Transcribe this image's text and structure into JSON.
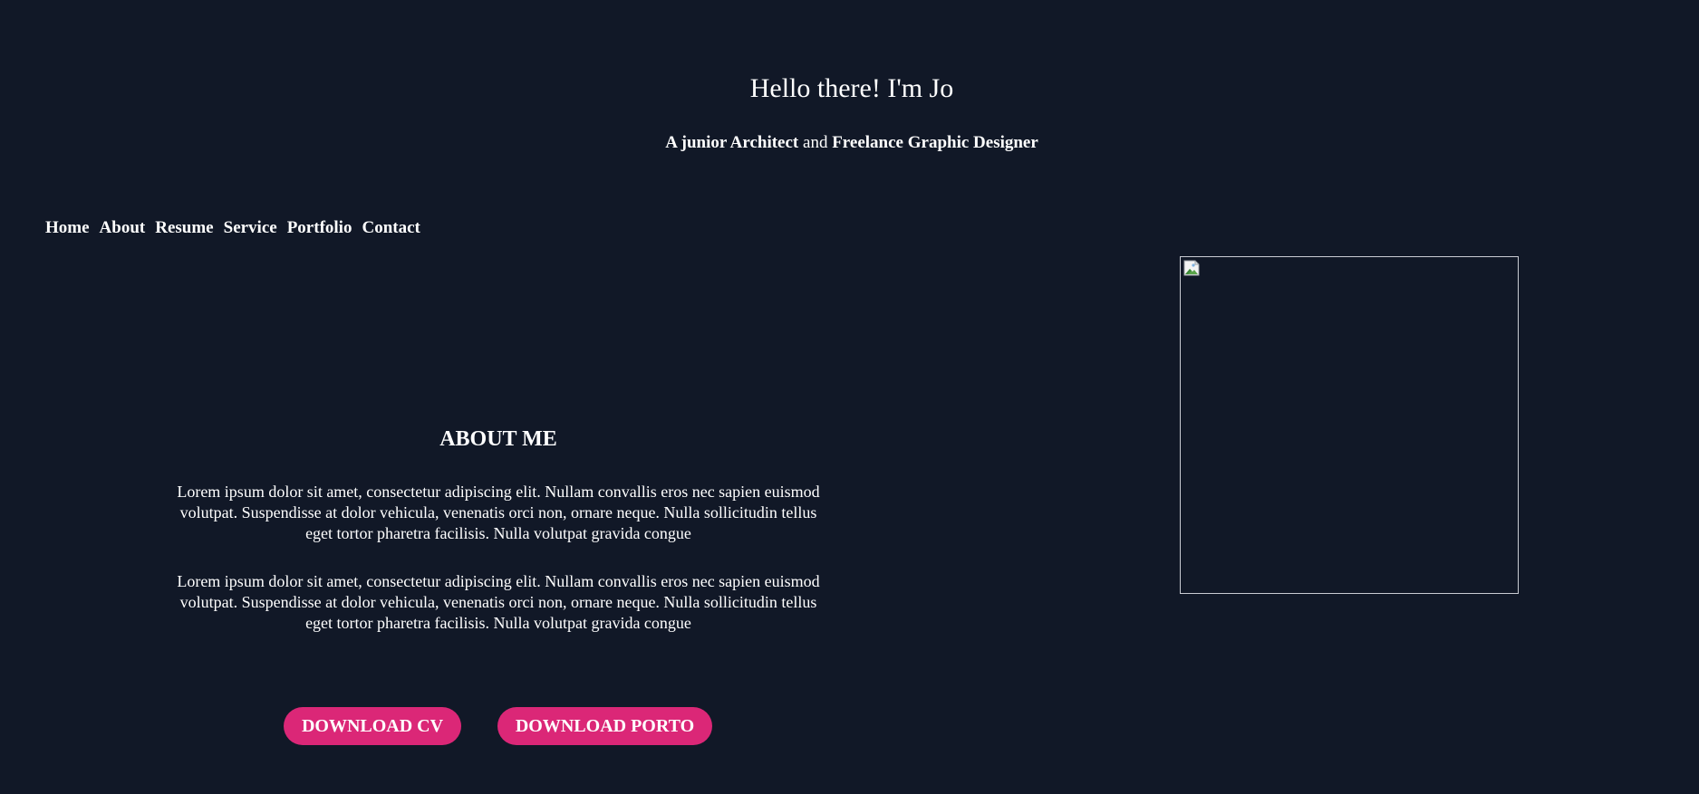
{
  "hero": {
    "title": "Hello there! I'm Jo",
    "subtitle": {
      "role1": "A junior Architect",
      "connector": "and",
      "role2": "Freelance Graphic Designer"
    }
  },
  "nav": {
    "items": [
      {
        "label": "Home"
      },
      {
        "label": "About"
      },
      {
        "label": "Resume"
      },
      {
        "label": "Service"
      },
      {
        "label": "Portfolio"
      },
      {
        "label": "Contact"
      }
    ]
  },
  "about": {
    "heading": "ABOUT ME",
    "paragraphs": [
      "Lorem ipsum dolor sit amet, consectetur adipiscing elit. Nullam convallis eros nec sapien euismod volutpat. Suspendisse at dolor vehicula, venenatis orci non, ornare neque. Nulla sollicitudin tellus eget tortor pharetra facilisis. Nulla volutpat gravida congue",
      "Lorem ipsum dolor sit amet, consectetur adipiscing elit. Nullam convallis eros nec sapien euismod volutpat. Suspendisse at dolor vehicula, venenatis orci non, ornare neque. Nulla sollicitudin tellus eget tortor pharetra facilisis. Nulla volutpat gravida congue"
    ]
  },
  "buttons": {
    "download_cv": "DOWNLOAD CV",
    "download_porto": "DOWNLOAD PORTO"
  },
  "profile_image": {
    "icon": "broken-image-icon"
  },
  "colors": {
    "background": "#111827",
    "text": "#ffffff",
    "accent": "#db2777",
    "image_border": "#c9ccd3"
  }
}
